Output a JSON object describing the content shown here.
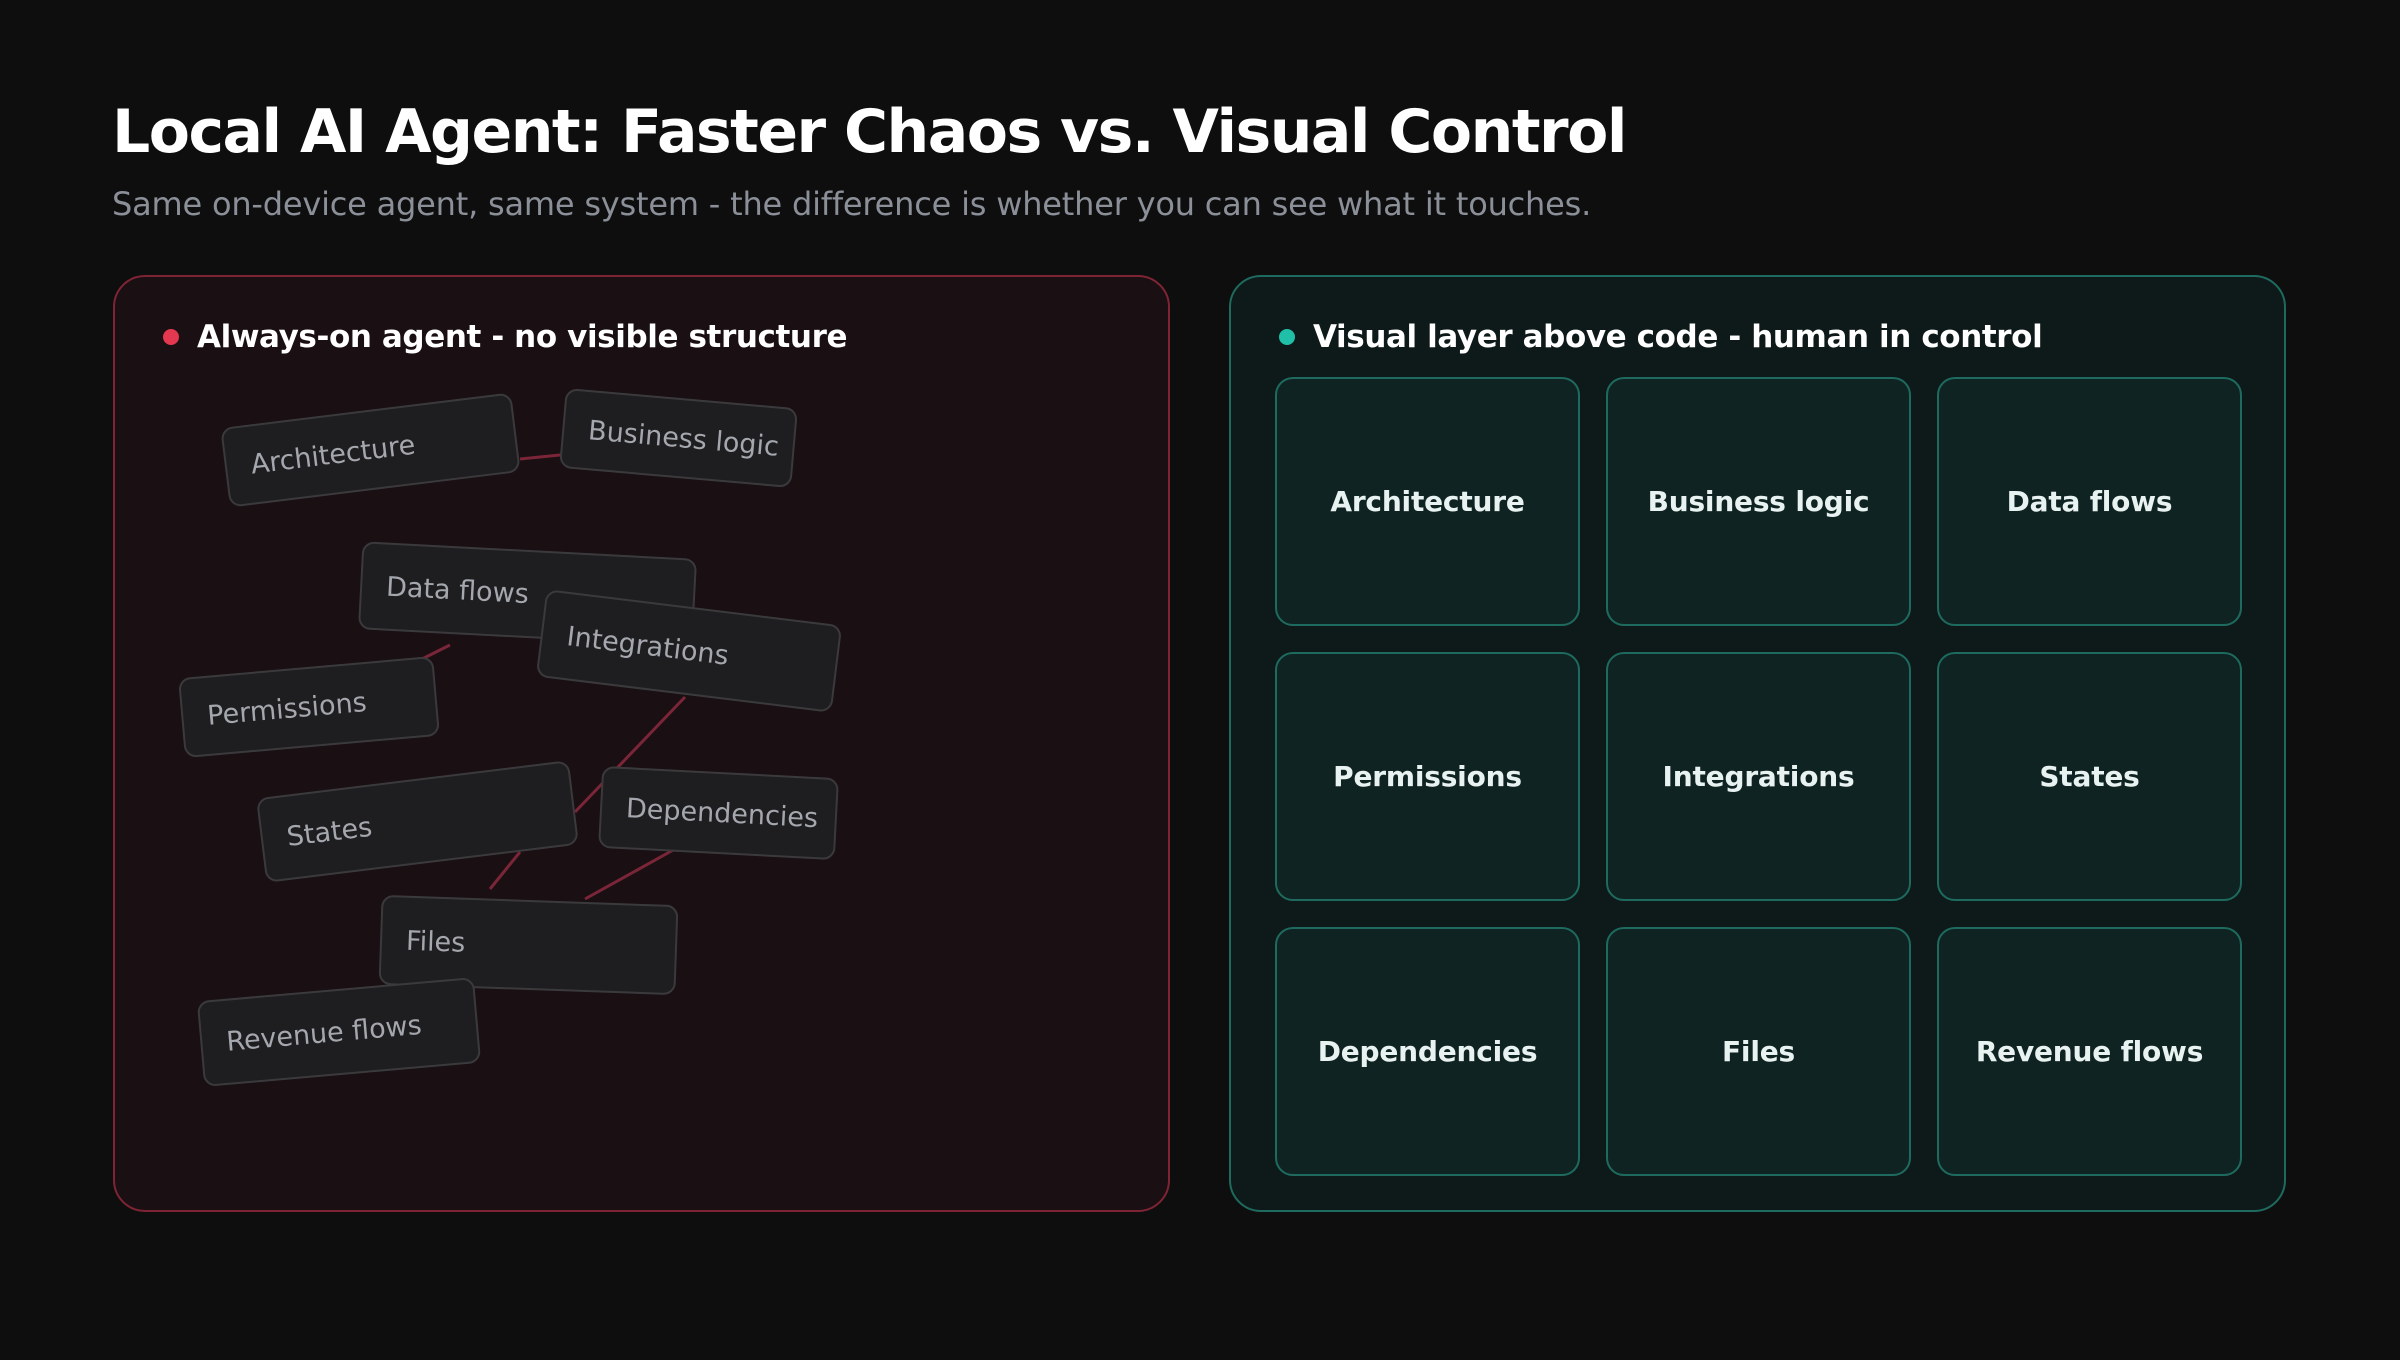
{
  "header": {
    "title": "Local AI Agent: Faster Chaos vs. Visual Control",
    "subtitle": "Same on-device agent, same system - the difference is whether you can see what it touches."
  },
  "colors": {
    "background": "#0e0e0f",
    "chaos_accent": "#e3384f",
    "control_accent": "#20c0a8"
  },
  "left_panel": {
    "label": "Always-on agent - no visible structure",
    "cards": [
      "Architecture",
      "Business logic",
      "Data flows",
      "Integrations",
      "Permissions",
      "States",
      "Dependencies",
      "Files",
      "Revenue flows"
    ]
  },
  "right_panel": {
    "label": "Visual layer above code - human in control",
    "cards": [
      "Architecture",
      "Business logic",
      "Data flows",
      "Permissions",
      "Integrations",
      "States",
      "Dependencies",
      "Files",
      "Revenue flows"
    ]
  }
}
